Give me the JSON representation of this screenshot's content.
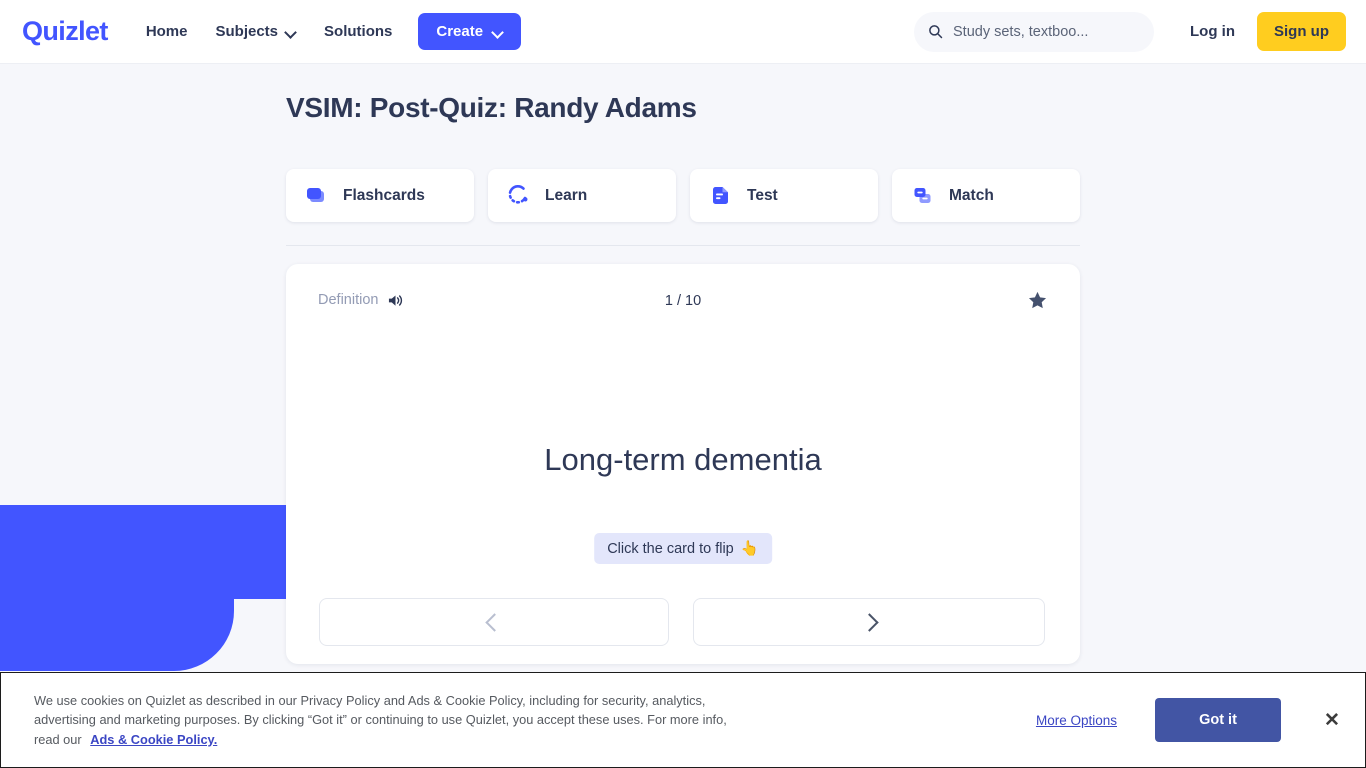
{
  "colors": {
    "brand_blue": "#4255FF",
    "signup_yellow": "#FFCD1F",
    "text_navy": "#2E3856",
    "muted_gray": "#939BB4",
    "page_bg": "#F6F7FB",
    "cookie_button": "#4255A4",
    "cookie_link": "#3B46C4",
    "flip_hint_bg": "#E3E6FB"
  },
  "header": {
    "logo": "Quizlet",
    "nav": [
      {
        "label": "Home",
        "has_caret": false,
        "icon": ""
      },
      {
        "label": "Subjects",
        "has_caret": true,
        "icon": "chevron-down-icon"
      },
      {
        "label": "Solutions",
        "has_caret": false,
        "icon": ""
      }
    ],
    "create_label": "Create",
    "create_icon": "chevron-down-icon",
    "search": {
      "icon": "search-icon",
      "placeholder": "Study sets, textboo...",
      "value": ""
    },
    "login_label": "Log in",
    "signup_label": "Sign up"
  },
  "main": {
    "title": "VSIM: Post-Quiz: Randy Adams",
    "modes": [
      {
        "label": "Flashcards",
        "icon": "flashcards-icon",
        "active": true
      },
      {
        "label": "Learn",
        "icon": "learn-icon",
        "active": false
      },
      {
        "label": "Test",
        "icon": "test-icon",
        "active": false
      },
      {
        "label": "Match",
        "icon": "match-icon",
        "active": false
      }
    ]
  },
  "study_card": {
    "side_label": "Definition",
    "audio_icon": "speaker-icon",
    "counter": "1 / 10",
    "star_icon": "star-filled-icon",
    "term": "Long-term dementia",
    "flip_hint": "Click the card to flip",
    "flip_hint_emoji": "👆",
    "prev_icon": "chevron-left-icon",
    "next_icon": "chevron-right-icon"
  },
  "cookie_banner": {
    "text": "We use cookies on Quizlet as described in our Privacy Policy and Ads & Cookie Policy, including for security, analytics, advertising and marketing purposes. By clicking “Got it” or continuing to use Quizlet, you accept these uses. For more info, read our",
    "link_label": "Ads & Cookie Policy.",
    "more_options_label": "More Options",
    "accept_label": "Got it",
    "close_icon": "close-icon",
    "close_glyph": "✕"
  }
}
